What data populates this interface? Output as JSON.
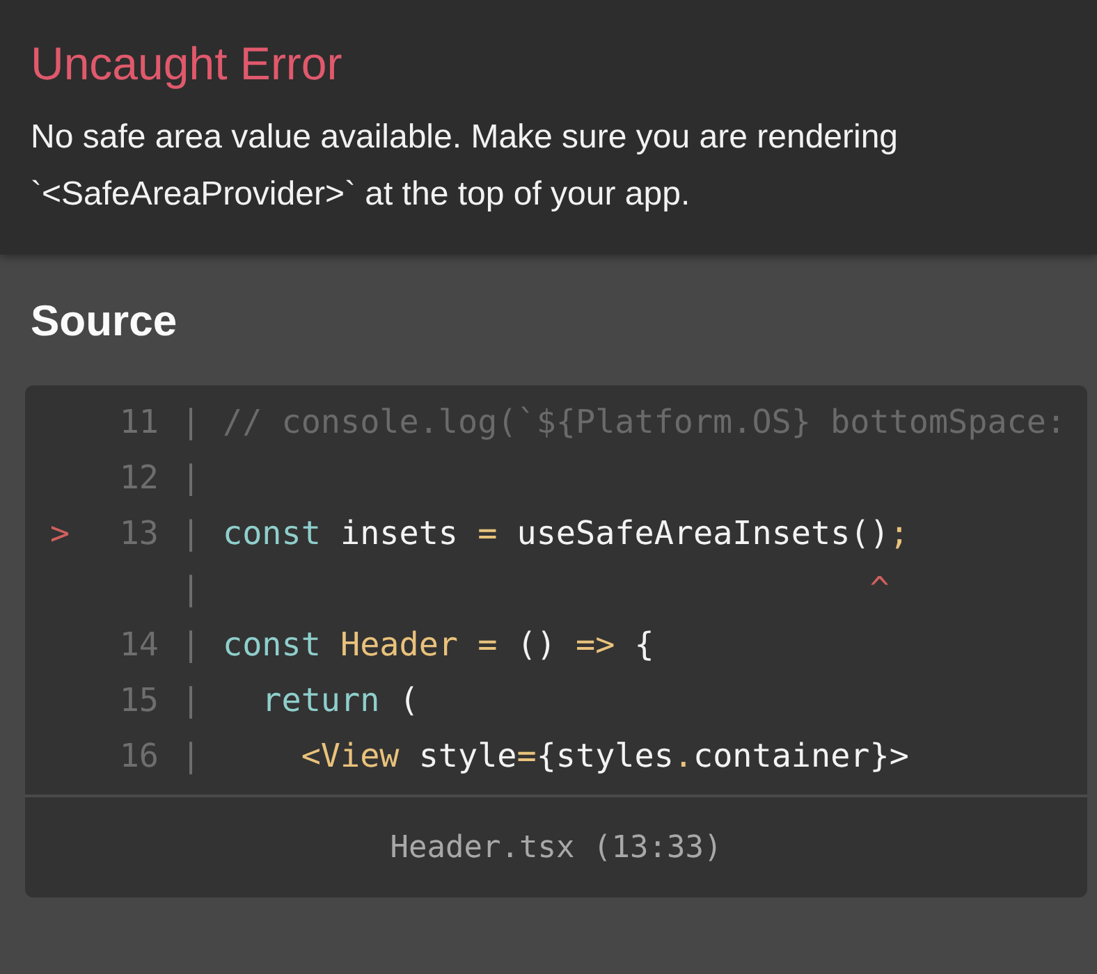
{
  "error": {
    "title": "Uncaught Error",
    "message": "No safe area value available. Make sure you are rendering `<SafeAreaProvider>` at the top of your app."
  },
  "source": {
    "heading": "Source",
    "lines": [
      {
        "number": "11",
        "gutter": "|",
        "tokens": [
          {
            "text": "// console.log(`${Platform.OS} bottomSpace:",
            "kind": "comment"
          }
        ]
      },
      {
        "number": "12",
        "gutter": "|"
      },
      {
        "number": "13",
        "marker": ">",
        "gutter": "|",
        "caret_gutter": "|",
        "tokens": [
          {
            "text": "const",
            "kind": "keyword"
          },
          {
            "text": " insets ",
            "kind": "plain"
          },
          {
            "text": "=",
            "kind": "operator"
          },
          {
            "text": " useSafeAreaInsets(",
            "kind": "plain"
          },
          {
            "text": ")",
            "kind": "plain",
            "caret": "^"
          },
          {
            "text": ";",
            "kind": "operator"
          }
        ]
      },
      {
        "number": "14",
        "gutter": "|",
        "tokens": [
          {
            "text": "const",
            "kind": "keyword"
          },
          {
            "text": " Header",
            "kind": "name"
          },
          {
            "text": " =",
            "kind": "operator"
          },
          {
            "text": " () ",
            "kind": "plain"
          },
          {
            "text": "=>",
            "kind": "operator"
          },
          {
            "text": " {",
            "kind": "plain"
          }
        ]
      },
      {
        "number": "15",
        "gutter": "|",
        "tokens": [
          {
            "text": "  return",
            "kind": "keyword"
          },
          {
            "text": " (",
            "kind": "plain"
          }
        ]
      },
      {
        "number": "16",
        "gutter": "|",
        "tokens": [
          {
            "text": "    <View",
            "kind": "name"
          },
          {
            "text": " style",
            "kind": "plain"
          },
          {
            "text": "=",
            "kind": "operator"
          },
          {
            "text": "{styles",
            "kind": "plain"
          },
          {
            "text": ".",
            "kind": "operator"
          },
          {
            "text": "container}>",
            "kind": "plain"
          }
        ]
      }
    ],
    "location": "Header.tsx (13:33)"
  }
}
